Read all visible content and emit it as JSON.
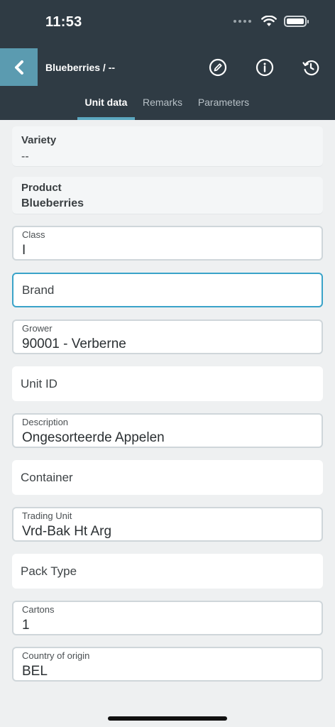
{
  "status_bar": {
    "time": "11:53"
  },
  "nav": {
    "title": "Blueberries / --",
    "back_icon": "chevron-left-icon",
    "actions": [
      {
        "name": "edit",
        "icon": "pencil-circle-icon"
      },
      {
        "name": "info",
        "icon": "info-circle-icon"
      },
      {
        "name": "history",
        "icon": "history-icon"
      }
    ]
  },
  "tabs": [
    {
      "label": "Unit data",
      "active": true
    },
    {
      "label": "Remarks",
      "active": false
    },
    {
      "label": "Parameters",
      "active": false
    }
  ],
  "fields": {
    "variety": {
      "label": "Variety",
      "value": "--"
    },
    "product": {
      "label": "Product",
      "value": "Blueberries"
    },
    "class": {
      "label": "Class",
      "value": "I"
    },
    "brand": {
      "placeholder": "Brand"
    },
    "grower": {
      "label": "Grower",
      "value": "90001 - Verberne"
    },
    "unit_id": {
      "placeholder": "Unit ID"
    },
    "description": {
      "label": "Description",
      "value": "Ongesorteerde Appelen"
    },
    "container": {
      "placeholder": "Container"
    },
    "trading_unit": {
      "label": "Trading Unit",
      "value": "Vrd-Bak Ht Arg"
    },
    "pack_type": {
      "placeholder": "Pack Type"
    },
    "cartons": {
      "label": "Cartons",
      "value": "1"
    },
    "country_of_origin": {
      "label": "Country of origin",
      "value": "BEL"
    }
  },
  "colors": {
    "header_bg": "#2f3b44",
    "accent": "#5ba7c0",
    "focus_border": "#3aa3c9",
    "page_bg": "#eef0f1"
  }
}
